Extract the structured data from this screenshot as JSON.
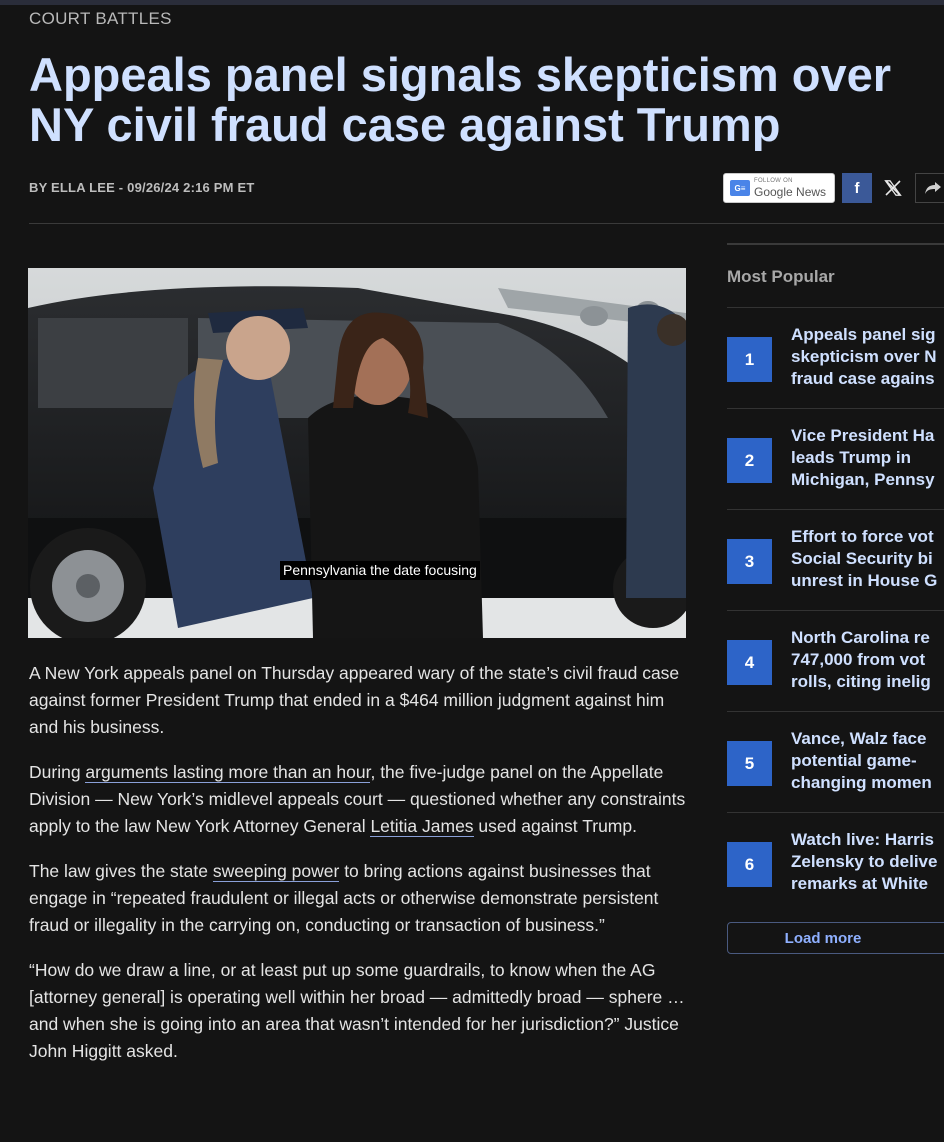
{
  "article": {
    "kicker": "COURT BATTLES",
    "headline_line1": "Appeals panel signals skepticism over",
    "headline_line2": "NY civil fraud case against Trump",
    "byline": "BY ELLA LEE - 09/26/24 2:16 PM ET",
    "share": {
      "google_news_small": "FOLLOW ON",
      "google_news_label": "Google News",
      "google_news_icon": "G≡",
      "facebook_label": "f",
      "icons": [
        "google-news-icon",
        "facebook-icon",
        "x-icon",
        "share-icon"
      ]
    },
    "image_caption": "Pennsylvania the date focusing",
    "paragraphs": [
      {
        "text": "A New York appeals panel on Thursday appeared wary of the state’s civil fraud case against former President Trump that ended in a $464 million judgment against him and his business."
      },
      {
        "before": "During ",
        "link": "arguments lasting more than an hour",
        "mid": ", the five-judge panel on the Appellate Division — New York’s midlevel appeals court — questioned whether any constraints apply to the law New York Attorney General ",
        "link2": "Letitia James",
        "after": " used against Trump."
      },
      {
        "before": "The law gives the state ",
        "link": "sweeping power",
        "after": " to bring actions against businesses that engage in “repeated fraudulent or illegal acts or otherwise demonstrate persistent fraud or illegality in the carrying on, conducting or transaction of business.”"
      },
      {
        "text": "“How do we draw a line, or at least put up some guardrails, to know when the AG [attorney general] is operating well within her broad — admittedly broad — sphere … and when she is going into an area that wasn’t intended for her jurisdiction?” Justice John Higgitt asked."
      }
    ]
  },
  "sidebar": {
    "title": "Most Popular",
    "items": [
      {
        "num": "1",
        "l1": "Appeals panel sig",
        "l2": "skepticism over N",
        "l3": "fraud case agains"
      },
      {
        "num": "2",
        "l1": "Vice President Ha",
        "l2": "leads Trump in",
        "l3": "Michigan, Pennsy"
      },
      {
        "num": "3",
        "l1": "Effort to force vot",
        "l2": "Social Security bi",
        "l3": "unrest in House G"
      },
      {
        "num": "4",
        "l1": "North Carolina re",
        "l2": "747,000 from vot",
        "l3": "rolls, citing inelig"
      },
      {
        "num": "5",
        "l1": "Vance, Walz face",
        "l2": "potential game-",
        "l3": "changing momen"
      },
      {
        "num": "6",
        "l1": "Watch live: Harris",
        "l2": "Zelensky to delive",
        "l3": "remarks at White"
      }
    ],
    "load_more": "Load more"
  },
  "colors": {
    "background": "#141414",
    "headline": "#cfe0ff",
    "accent_blue": "#2d64c8",
    "facebook": "#3b5998"
  }
}
